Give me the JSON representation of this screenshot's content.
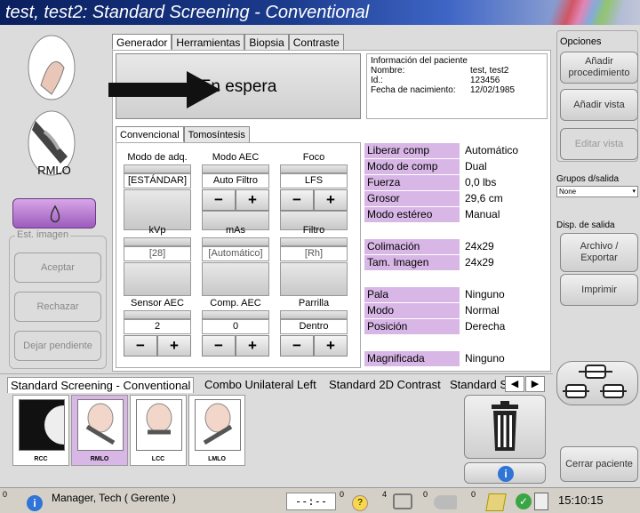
{
  "window": {
    "title": "test, test2:  Standard Screening - Conventional"
  },
  "left": {
    "view_label": "RMLO",
    "image_section": "Est. imagen",
    "accept": "Aceptar",
    "reject": "Rechazar",
    "pending": "Dejar pendiente"
  },
  "tabs": [
    "Generador",
    "Herramientas",
    "Biopsia",
    "Contraste"
  ],
  "status_box": {
    "text": "En espera"
  },
  "patient": {
    "header": "Información del paciente",
    "name_label": "Nombre:",
    "name": "test, test2",
    "id_label": "Id.:",
    "id": "123456",
    "dob_label": "Fecha de nacimiento:",
    "dob": "12/02/1985"
  },
  "subtabs": [
    "Convencional",
    "Tomosíntesis"
  ],
  "params": {
    "mode_label": "Modo de adq.",
    "mode_value": "[ESTÁNDAR]",
    "aec_mode_label": "Modo AEC",
    "aec_mode_value": "Auto Filtro",
    "focus_label": "Foco",
    "focus_value": "LFS",
    "kvp_label": "kVp",
    "kvp_value": "[28]",
    "mas_label": "mAs",
    "mas_value": "[Automático]",
    "filter_label": "Filtro",
    "filter_value": "[Rh]",
    "sensor_label": "Sensor AEC",
    "sensor_value": "2",
    "comp_label": "Comp. AEC",
    "comp_value": "0",
    "grid_label": "Parrilla",
    "grid_value": "Dentro",
    "minus": "−",
    "plus": "+"
  },
  "info_table": [
    {
      "label": "Liberar comp",
      "value": "Automático"
    },
    {
      "label": "Modo de comp",
      "value": "Dual"
    },
    {
      "label": "Fuerza",
      "value": "0,0 lbs"
    },
    {
      "label": "Grosor",
      "value": "29,6 cm"
    },
    {
      "label": "Modo estéreo",
      "value": "Manual"
    },
    {
      "label": "Colimación",
      "value": "24x29"
    },
    {
      "label": "Tam. Imagen",
      "value": "24x29"
    },
    {
      "label": "Pala",
      "value": "Ninguno"
    },
    {
      "label": "Modo",
      "value": "Normal"
    },
    {
      "label": "Posición",
      "value": "Derecha"
    },
    {
      "label": "Magnificada",
      "value": "Ninguno"
    }
  ],
  "right": {
    "options": "Opciones",
    "add_procedure": "Añadir procedimiento",
    "add_view": "Añadir vista",
    "edit_view": "Editar vista",
    "output_groups": "Grupos d/salida",
    "output_select": "None",
    "output_devices": "Disp. de salida",
    "archive": "Archivo / Exportar",
    "print": "Imprimir",
    "close_patient": "Cerrar paciente"
  },
  "procedure_tabs": [
    "Standard Screening - Conventional",
    "Combo Unilateral Left",
    "Standard 2D Contrast",
    "Standard S"
  ],
  "thumbnails": [
    "RCC",
    "RMLO",
    "LCC",
    "LMLO"
  ],
  "statusbar": {
    "count0": "0",
    "user": "Manager, Tech ( Gerente )",
    "timer": "--:--",
    "c1": "0",
    "c2": "4",
    "c3": "0",
    "c4": "0",
    "time": "15:10:15"
  },
  "colors": {
    "accent": "#d8b7e6",
    "titlebar": "#0a1f5e",
    "purple_btn": "#b07ccf"
  }
}
